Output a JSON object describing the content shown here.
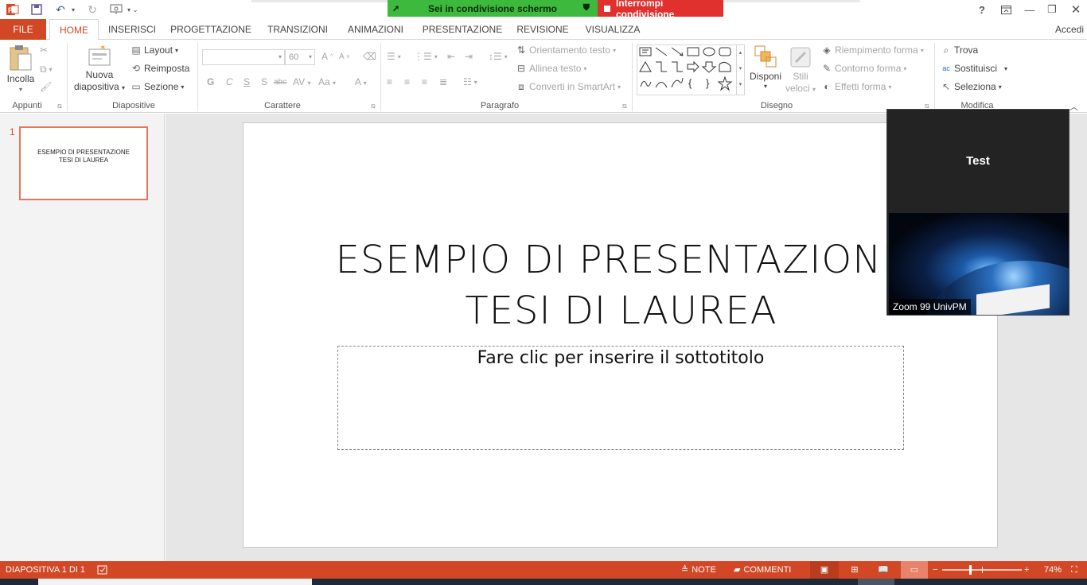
{
  "titlebar": {
    "help": "?",
    "signin": "Accedi"
  },
  "share": {
    "status": "Sei in condivisione schermo",
    "stop": "Interrompi condivisione"
  },
  "tabs": [
    "FILE",
    "HOME",
    "INSERISCI",
    "PROGETTAZIONE",
    "TRANSIZIONI",
    "ANIMAZIONI",
    "PRESENTAZIONE",
    "REVISIONE",
    "VISUALIZZA"
  ],
  "ribbon": {
    "clipboard": {
      "paste": "Incolla",
      "group": "Appunti"
    },
    "slides": {
      "new_slide_1": "Nuova",
      "new_slide_2": "diapositiva",
      "layout": "Layout",
      "reset": "Reimposta",
      "section": "Sezione",
      "group": "Diapositive"
    },
    "font": {
      "size": "60",
      "bold": "G",
      "italic": "C",
      "underline": "S",
      "shadow": "S",
      "strike": "abc",
      "spacing": "AV",
      "case": "Aa",
      "color": "A",
      "group": "Carattere"
    },
    "paragraph": {
      "text_direction": "Orientamento testo",
      "align_text": "Allinea testo",
      "smartart": "Converti in SmartArt",
      "group": "Paragrafo"
    },
    "drawing": {
      "arrange": "Disponi",
      "quick_styles_1": "Stili",
      "quick_styles_2": "veloci",
      "fill": "Riempimento forma",
      "outline": "Contorno forma",
      "effects": "Effetti forma",
      "group": "Disegno"
    },
    "editing": {
      "find": "Trova",
      "replace": "Sostituisci",
      "select": "Seleziona",
      "group": "Modifica"
    }
  },
  "thumbnail": {
    "number": "1",
    "line1": "ESEMPIO DI PRESENTAZIONE",
    "line2": "TESI DI LAUREA"
  },
  "slide": {
    "title_line1": "ESEMPIO DI PRESENTAZIONE",
    "title_line2": "TESI DI LAUREA",
    "subtitle_placeholder": "Fare clic per inserire il sottotitolo"
  },
  "zoom": {
    "participant": "Test",
    "label": "Zoom 99 UnivPM"
  },
  "statusbar": {
    "slide_info": "DIAPOSITIVA 1 DI 1",
    "notes": "NOTE",
    "comments": "COMMENTI",
    "zoom": "74%"
  },
  "colors": {
    "accent": "#d24726",
    "share_green": "#3db93d",
    "share_red": "#e0312f"
  }
}
